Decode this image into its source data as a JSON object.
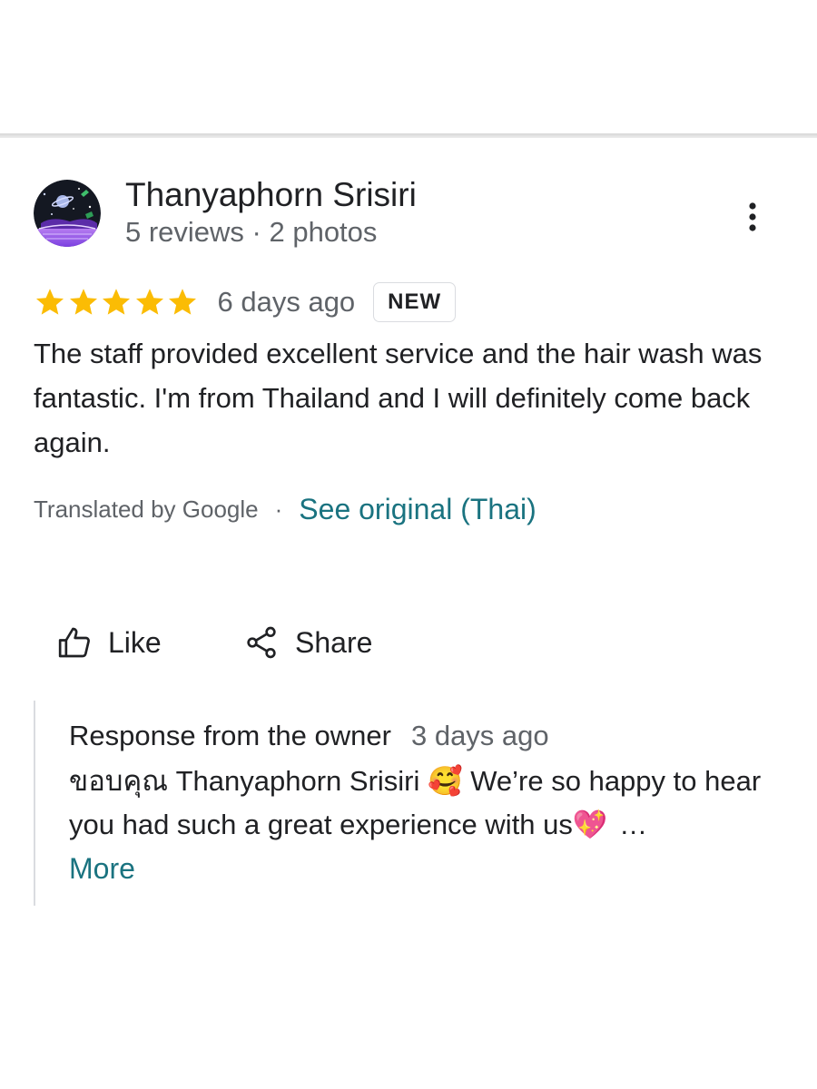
{
  "review": {
    "reviewer_name": "Thanyaphorn Srisiri",
    "reviewer_meta": "5 reviews · 2 photos",
    "avatar_icon": "space-planet-avatar",
    "menu_icon": "more-vert-icon",
    "rating": 5,
    "rating_max": 5,
    "star_color": "#fbbc04",
    "date": "6 days ago",
    "badge": "NEW",
    "text": "The staff provided excellent service and the hair wash was fantastic. I'm from Thailand and I will definitely come back again.",
    "translated_by": "Translated by Google",
    "separator": "·",
    "see_original": "See original (Thai)",
    "link_color": "#1a7380"
  },
  "actions": {
    "like_label": "Like",
    "like_icon": "thumb-up-icon",
    "share_label": "Share",
    "share_icon": "share-icon"
  },
  "owner_response": {
    "title": "Response from the owner",
    "date": "3 days ago",
    "text_start": "ขอบคุณ Thanyaphorn Srisiri ",
    "emoji_1": "🥰",
    "text_middle": " We’re so happy to hear you had such a great experience with us",
    "emoji_2": "💖",
    "ellipsis": " …",
    "more_label": "More"
  }
}
